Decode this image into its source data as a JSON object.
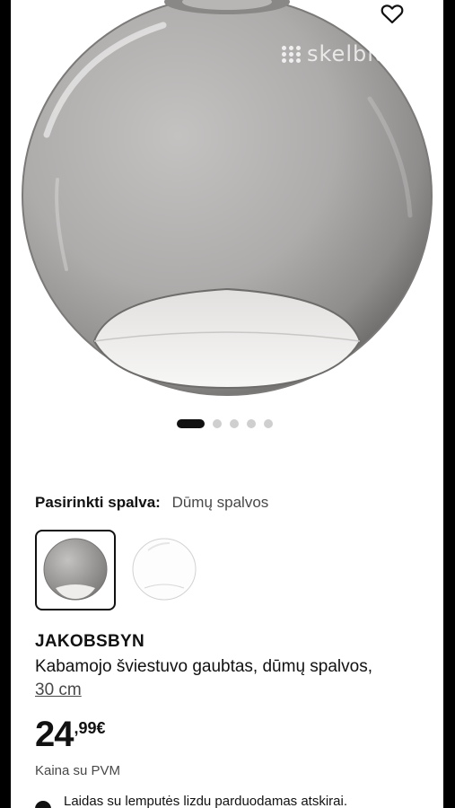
{
  "watermark": "skelbiu.lt",
  "icons": {
    "favorite": "heart-outline-icon",
    "info": "info-icon"
  },
  "carousel": {
    "total": 5,
    "active": 1
  },
  "color_selector": {
    "label": "Pasirinkti spalva:",
    "value": "Dūmų spalvos",
    "options": [
      {
        "name": "smoke",
        "selected": true
      },
      {
        "name": "clear",
        "selected": false
      }
    ]
  },
  "product": {
    "name": "JAKOBSBYN",
    "description": "Kabamojo šviestuvo gaubtas, dūmų spalvos,",
    "size": "30 cm",
    "price_int": "24",
    "price_dec": ",99",
    "currency": "€",
    "vat_note": "Kaina su PVM",
    "note": "Laidas su lemputės lizdu parduodamas atskirai."
  },
  "colors": {
    "text": "#111111",
    "muted": "#484848",
    "dot_inactive": "#cfcfcf"
  }
}
